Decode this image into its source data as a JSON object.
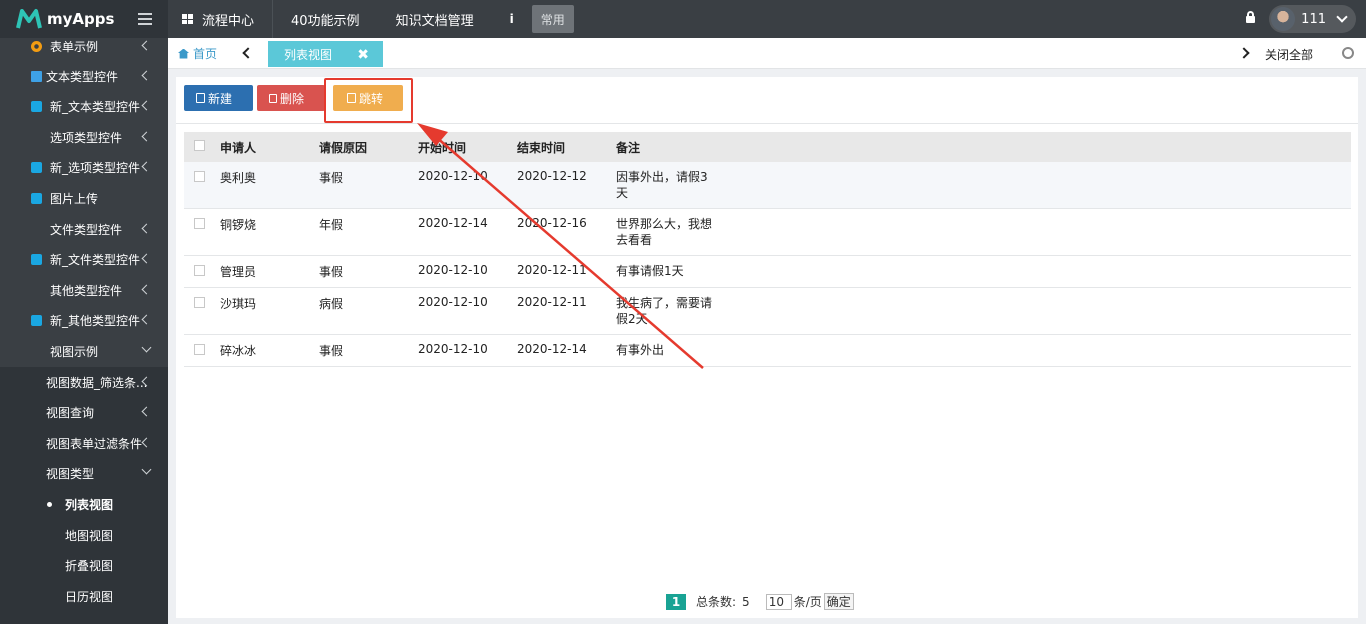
{
  "app": {
    "name": "myApps"
  },
  "topnav": {
    "items": [
      "流程中心",
      "40功能示例",
      "知识文档管理"
    ],
    "info": "i",
    "common": "常用"
  },
  "user": {
    "name": "111"
  },
  "sidebar": {
    "items": [
      {
        "label": "表单示例",
        "icon": "gear-icon"
      },
      {
        "label": "文本类型控件",
        "icon": "document-icon"
      },
      {
        "label": "新_文本类型控件",
        "icon": "cube-icon"
      },
      {
        "label": "选项类型控件",
        "icon": ""
      },
      {
        "label": "新_选项类型控件",
        "icon": "cube-icon"
      },
      {
        "label": "图片上传",
        "icon": "cube-icon"
      },
      {
        "label": "文件类型控件",
        "icon": ""
      },
      {
        "label": "新_文件类型控件",
        "icon": "cube-icon"
      },
      {
        "label": "其他类型控件",
        "icon": ""
      },
      {
        "label": "新_其他类型控件",
        "icon": "cube-icon"
      },
      {
        "label": "视图示例",
        "icon": ""
      },
      {
        "label": "视图数据_筛选条...",
        "icon": ""
      },
      {
        "label": "视图查询",
        "icon": ""
      },
      {
        "label": "视图表单过滤条件",
        "icon": ""
      },
      {
        "label": "视图类型",
        "icon": ""
      },
      {
        "label": "列表视图",
        "icon": ""
      },
      {
        "label": "地图视图",
        "icon": ""
      },
      {
        "label": "折叠视图",
        "icon": ""
      },
      {
        "label": "日历视图",
        "icon": ""
      }
    ]
  },
  "tabs": {
    "home": "首页",
    "active": "列表视图",
    "close_all": "关闭全部"
  },
  "toolbar": {
    "new": "新建",
    "delete": "删除",
    "jump": "跳转"
  },
  "table": {
    "headers": [
      "申请人",
      "请假原因",
      "开始时间",
      "结束时间",
      "备注"
    ],
    "rows": [
      [
        "奥利奥",
        "事假",
        "2020-12-10",
        "2020-12-12",
        "因事外出，请假3天"
      ],
      [
        "铜锣烧",
        "年假",
        "2020-12-14",
        "2020-12-16",
        "世界那么大，我想去看看"
      ],
      [
        "管理员",
        "事假",
        "2020-12-10",
        "2020-12-11",
        "有事请假1天"
      ],
      [
        "沙琪玛",
        "病假",
        "2020-12-10",
        "2020-12-11",
        "我生病了，需要请假2天"
      ],
      [
        "碎冰冰",
        "事假",
        "2020-12-10",
        "2020-12-14",
        "有事外出"
      ]
    ]
  },
  "pager": {
    "current": "1",
    "total_label": "总条数:",
    "total": "5",
    "page_size": "10",
    "unit": "条/页",
    "confirm": "确定"
  },
  "colors": {
    "accent": "#5bc8d8",
    "annotation": "#e53a2e"
  }
}
